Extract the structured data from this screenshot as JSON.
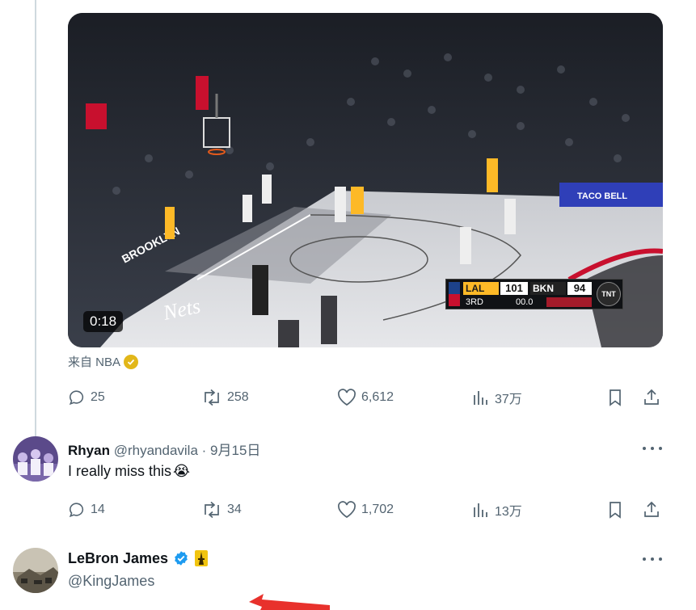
{
  "video": {
    "duration": "0:18",
    "scorebug": {
      "team1": "LAL",
      "score1": "101",
      "team2": "BKN",
      "score2": "94",
      "period": "3RD",
      "clock": "00.0",
      "network": "TNT"
    },
    "arena_ad": "TACO BELL"
  },
  "source": {
    "label": "来自 NBA",
    "badge_icon": "gold-verified-badge-icon"
  },
  "tweet_actions": {
    "replies": "25",
    "reposts": "258",
    "likes": "6,612",
    "views": "37万"
  },
  "reply": {
    "name": "Rhyan",
    "handle": "@rhyandavila",
    "separator": "·",
    "date": "9月15日",
    "text": "I really miss this",
    "emoji": "😭",
    "actions": {
      "replies": "14",
      "reposts": "34",
      "likes": "1,702",
      "views": "13万"
    }
  },
  "next_reply": {
    "name": "LeBron James",
    "handle": "@KingJames",
    "badge_icon": "blue-verified-badge-icon",
    "extra_icon": "crown-icon"
  },
  "colors": {
    "text_primary": "#0f1419",
    "text_muted": "#536471",
    "verified_blue": "#1d9bf0",
    "gold": "#e2b719",
    "annotation_red": "#e8312c"
  }
}
